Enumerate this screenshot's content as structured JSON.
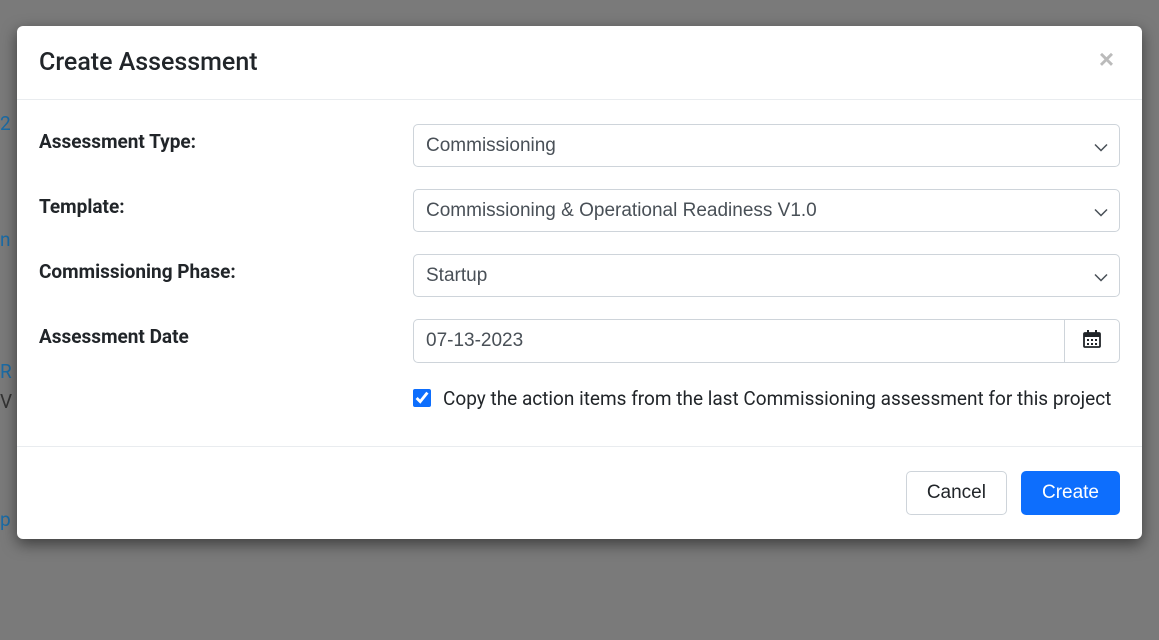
{
  "modal": {
    "title": "Create Assessment",
    "labels": {
      "assessment_type": "Assessment Type:",
      "template": "Template:",
      "commissioning_phase": "Commissioning Phase:",
      "assessment_date": "Assessment Date"
    },
    "values": {
      "assessment_type": "Commissioning",
      "template": "Commissioning & Operational Readiness V1.0",
      "commissioning_phase": "Startup",
      "assessment_date": "07-13-2023"
    },
    "checkbox": {
      "copy_action_items_label": "Copy the action items from the last Commissioning assessment for this project",
      "copy_action_items_checked": true
    },
    "buttons": {
      "cancel": "Cancel",
      "create": "Create"
    }
  }
}
